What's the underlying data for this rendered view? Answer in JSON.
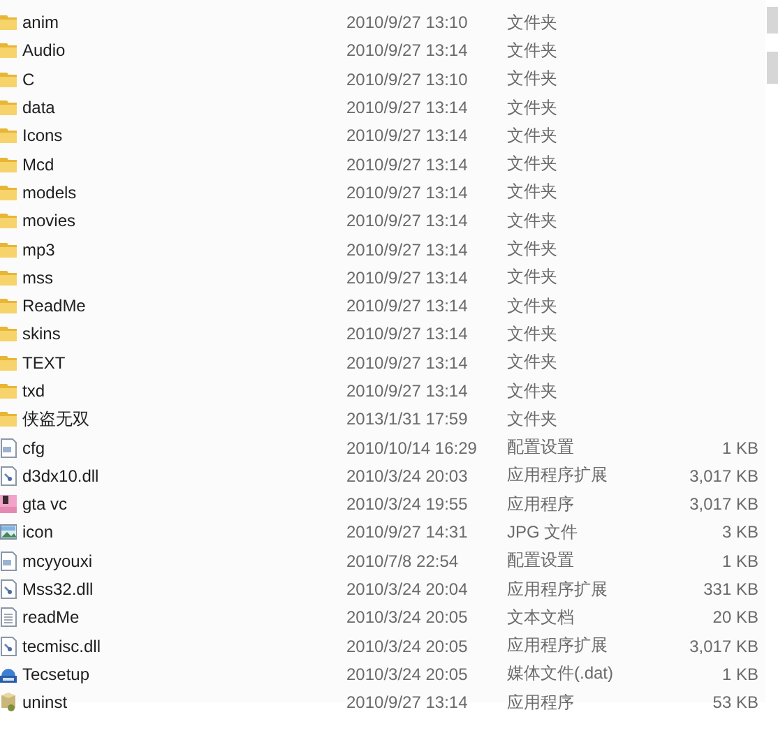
{
  "files": [
    {
      "name": "anim",
      "modified": "2010/9/27 13:10",
      "type": "文件夹",
      "kind": "folder"
    },
    {
      "name": "Audio",
      "modified": "2010/9/27 13:14",
      "type": "文件夹",
      "kind": "folder"
    },
    {
      "name": "C",
      "modified": "2010/9/27 13:10",
      "type": "文件夹",
      "kind": "folder"
    },
    {
      "name": "data",
      "modified": "2010/9/27 13:14",
      "type": "文件夹",
      "kind": "folder"
    },
    {
      "name": "Icons",
      "modified": "2010/9/27 13:14",
      "type": "文件夹",
      "kind": "folder"
    },
    {
      "name": "Mcd",
      "modified": "2010/9/27 13:14",
      "type": "文件夹",
      "kind": "folder"
    },
    {
      "name": "models",
      "modified": "2010/9/27 13:14",
      "type": "文件夹",
      "kind": "folder"
    },
    {
      "name": "movies",
      "modified": "2010/9/27 13:14",
      "type": "文件夹",
      "kind": "folder"
    },
    {
      "name": "mp3",
      "modified": "2010/9/27 13:14",
      "type": "文件夹",
      "kind": "folder"
    },
    {
      "name": "mss",
      "modified": "2010/9/27 13:14",
      "type": "文件夹",
      "kind": "folder"
    },
    {
      "name": "ReadMe",
      "modified": "2010/9/27 13:14",
      "type": "文件夹",
      "kind": "folder"
    },
    {
      "name": "skins",
      "modified": "2010/9/27 13:14",
      "type": "文件夹",
      "kind": "folder"
    },
    {
      "name": "TEXT",
      "modified": "2010/9/27 13:14",
      "type": "文件夹",
      "kind": "folder"
    },
    {
      "name": "txd",
      "modified": "2010/9/27 13:14",
      "type": "文件夹",
      "kind": "folder"
    },
    {
      "name": "侠盗无双",
      "modified": "2013/1/31 17:59",
      "type": "文件夹",
      "kind": "folder"
    },
    {
      "name": "cfg",
      "modified": "2010/10/14 16:29",
      "type": "配置设置",
      "size": "1 KB",
      "kind": "config"
    },
    {
      "name": "d3dx10.dll",
      "modified": "2010/3/24 20:03",
      "type": "应用程序扩展",
      "size": "3,017 KB",
      "kind": "dll"
    },
    {
      "name": "gta vc",
      "modified": "2010/3/24 19:55",
      "type": "应用程序",
      "size": "3,017 KB",
      "kind": "game"
    },
    {
      "name": "icon",
      "modified": "2010/9/27 14:31",
      "type": "JPG 文件",
      "size": "3 KB",
      "kind": "image"
    },
    {
      "name": "mcyyouxi",
      "modified": "2010/7/8 22:54",
      "type": "配置设置",
      "size": "1 KB",
      "kind": "config"
    },
    {
      "name": "Mss32.dll",
      "modified": "2010/3/24 20:04",
      "type": "应用程序扩展",
      "size": "331 KB",
      "kind": "dll"
    },
    {
      "name": "readMe",
      "modified": "2010/3/24 20:05",
      "type": "文本文档",
      "size": "20 KB",
      "kind": "text"
    },
    {
      "name": "tecmisc.dll",
      "modified": "2010/3/24 20:05",
      "type": "应用程序扩展",
      "size": "3,017 KB",
      "kind": "dll"
    },
    {
      "name": "Tecsetup",
      "modified": "2010/3/24 20:05",
      "type": "媒体文件(.dat)",
      "size": "1 KB",
      "kind": "media"
    },
    {
      "name": "uninst",
      "modified": "2010/9/27 13:14",
      "type": "应用程序",
      "size": "53 KB",
      "kind": "uninstaller"
    }
  ]
}
